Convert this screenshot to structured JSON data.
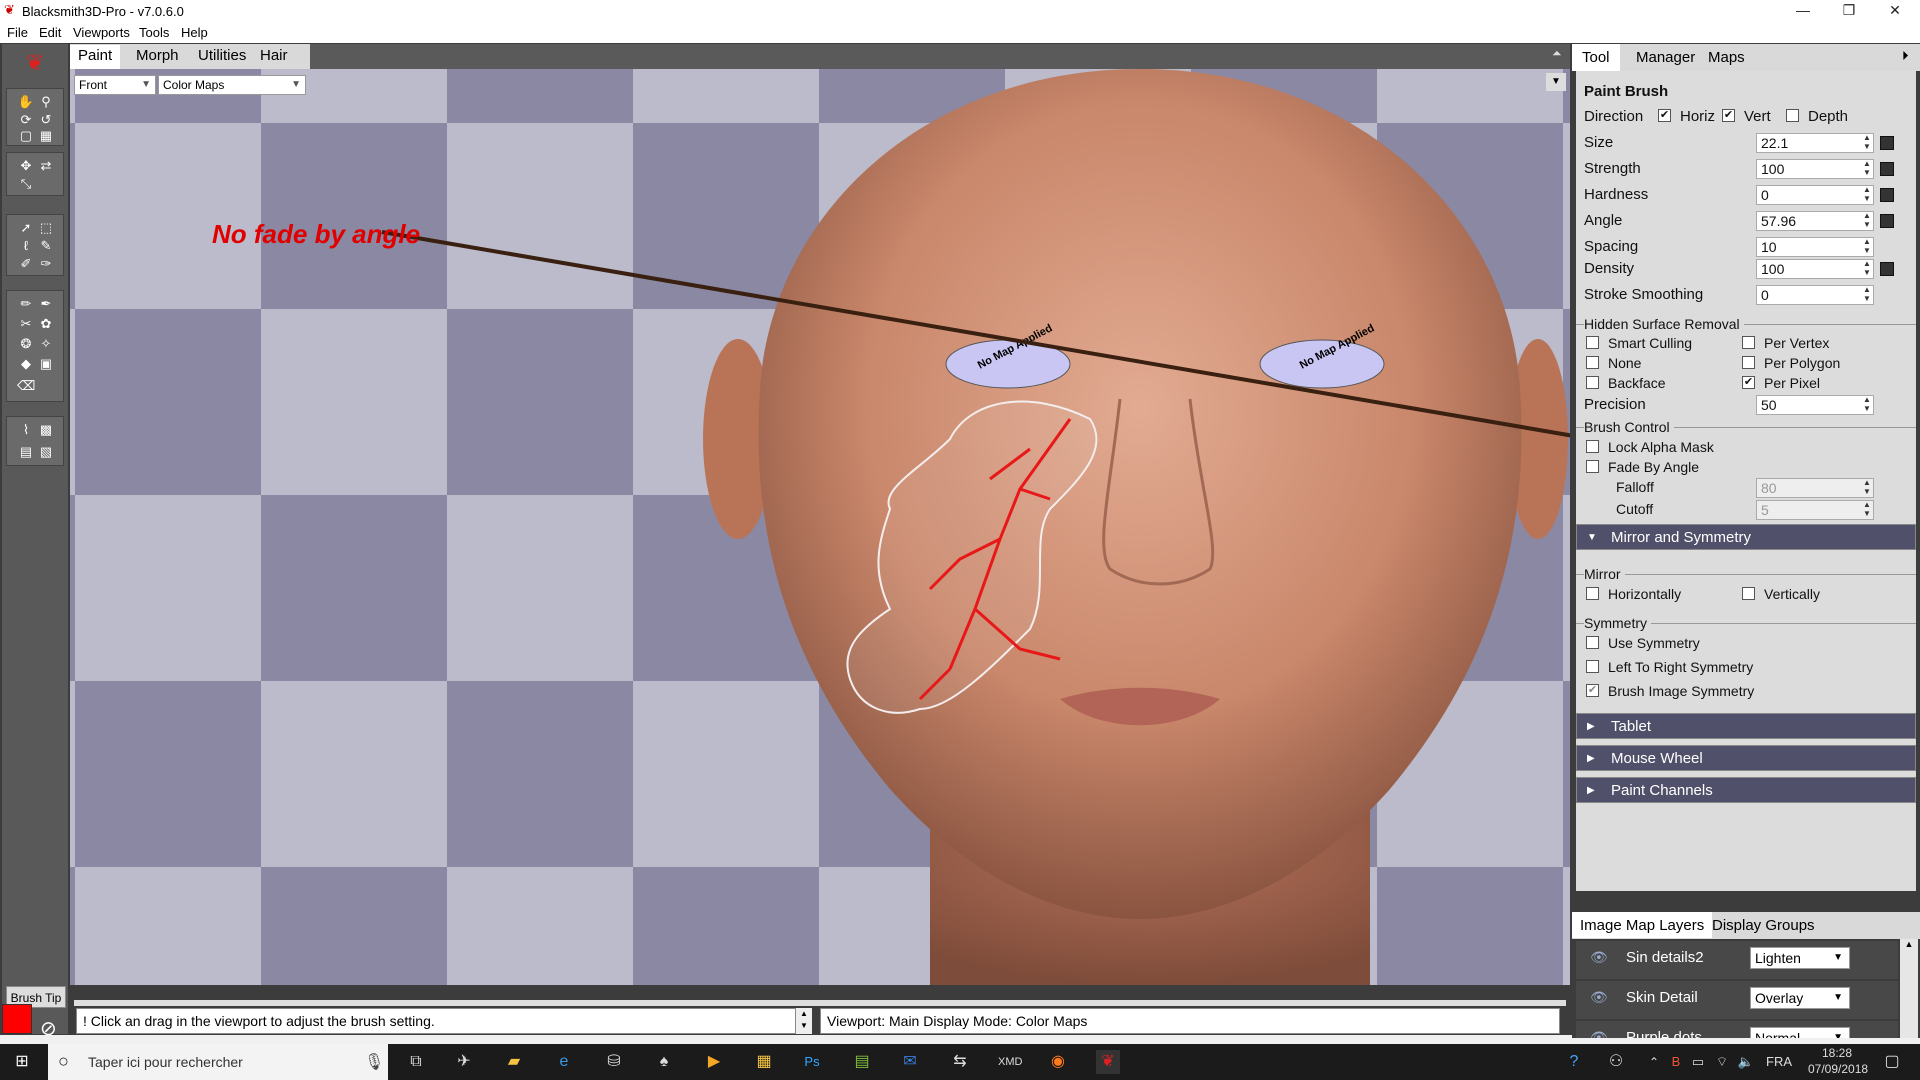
{
  "window": {
    "title": "Blacksmith3D-Pro - v7.0.6.0",
    "minimize": "—",
    "restore": "❐",
    "close": "✕"
  },
  "menu": [
    "File",
    "Edit",
    "Viewports",
    "Tools",
    "Help"
  ],
  "viewport_tabs": [
    "Paint",
    "Morph",
    "Utilities",
    "Hair"
  ],
  "view_combo": "Front",
  "mode_combo": "Color Maps",
  "annotation": "No fade by angle",
  "eye_text": "No Map Applied",
  "left_toolbar": {
    "brush_tip_label": "Brush Tip"
  },
  "right_tabs": [
    "Tool",
    "Manager",
    "Maps"
  ],
  "paint_brush": {
    "title": "Paint Brush",
    "direction_label": "Direction",
    "horiz": "Horiz",
    "vert": "Vert",
    "depth": "Depth",
    "size_label": "Size",
    "size": "22.1",
    "strength_label": "Strength",
    "strength": "100",
    "hardness_label": "Hardness",
    "hardness": "0",
    "angle_label": "Angle",
    "angle": "57.96",
    "spacing_label": "Spacing",
    "spacing": "10",
    "density_label": "Density",
    "density": "100",
    "smoothing_label": "Stroke Smoothing",
    "smoothing": "0"
  },
  "hsr": {
    "header": "Hidden Surface Removal",
    "smart_culling": "Smart Culling",
    "per_vertex": "Per Vertex",
    "none": "None",
    "per_polygon": "Per Polygon",
    "backface": "Backface",
    "per_pixel": "Per Pixel",
    "precision_label": "Precision",
    "precision": "50"
  },
  "brush_control": {
    "header": "Brush Control",
    "lock_alpha": "Lock Alpha Mask",
    "fade_by_angle": "Fade By Angle",
    "falloff_label": "Falloff",
    "falloff": "80",
    "cutoff_label": "Cutoff",
    "cutoff": "5"
  },
  "mirror_rollout": "Mirror and Symmetry",
  "mirror": {
    "header": "Mirror",
    "horizontally": "Horizontally",
    "vertically": "Vertically"
  },
  "symmetry": {
    "header": "Symmetry",
    "use": "Use Symmetry",
    "ltr": "Left To Right Symmetry",
    "brush_image": "Brush Image Symmetry"
  },
  "rollouts": [
    "Tablet",
    "Mouse Wheel",
    "Paint Channels"
  ],
  "layer_tabs": [
    "Image Map Layers",
    "Display Groups"
  ],
  "layers": [
    {
      "name": "Sin details2",
      "mode": "Lighten"
    },
    {
      "name": "Skin Detail",
      "mode": "Overlay"
    },
    {
      "name": "Purple dots",
      "mode": "Normal"
    }
  ],
  "status": {
    "left": "! Click an drag in the viewport to adjust the brush setting.",
    "right": "Viewport: Main Display Mode: Color Maps"
  },
  "taskbar": {
    "search_placeholder": "Taper ici pour rechercher",
    "lang": "FRA",
    "time": "18:28",
    "date": "07/09/2018"
  },
  "colors": {
    "annotation": "#e00000",
    "paint_swatch": "#ff0000",
    "rollout": "#50506a"
  }
}
